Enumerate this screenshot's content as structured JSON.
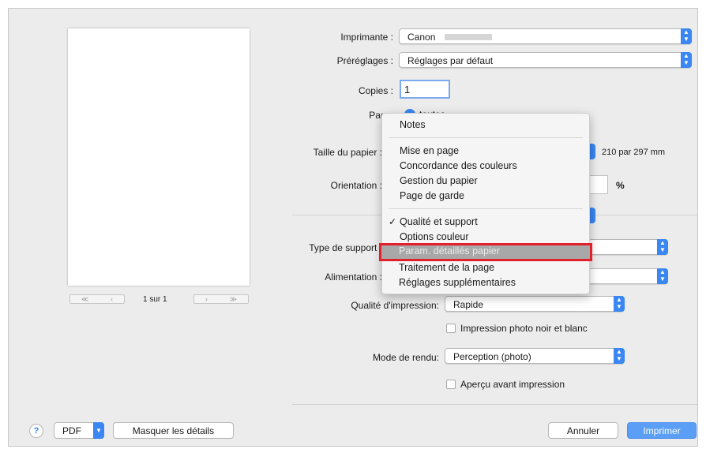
{
  "preview": {
    "page_counter": "1 sur 1",
    "first_label": "≪",
    "prev_label": "‹",
    "next_label": "›",
    "last_label": "≫"
  },
  "fields": {
    "printer_label": "Imprimante :",
    "printer_value": "Canon",
    "presets_label": "Préréglages :",
    "presets_value": "Réglages par défaut",
    "copies_label": "Copies :",
    "copies_value": "1",
    "pages_label": "Pages :",
    "pages_value": "toutes",
    "paper_size_label": "Taille du papier :",
    "paper_size_value": "210 par 297 mm",
    "orientation_label": "Orientation :",
    "scale_unit": "%",
    "media_type_label": "Type de support :",
    "paper_source_label": "Alimentation :",
    "print_quality_label": "Qualité d'impression:",
    "print_quality_value": "Rapide",
    "bw_photo_label": "Impression photo noir et blanc",
    "render_mode_label": "Mode de rendu:",
    "render_mode_value": "Perception (photo)",
    "preview_before_label": "Aperçu avant impression"
  },
  "menu": {
    "items": [
      "Notes",
      "Mise en page",
      "Concordance des couleurs",
      "Gestion du papier",
      "Page de garde",
      "Qualité et support",
      "Options couleur",
      "Param. détaillés papier",
      "Traitement de la page",
      "Réglages supplémentaires"
    ],
    "checked_mark": "✓",
    "highlighted_item": "Param. détaillés papier",
    "highlight_color": "#e2202b"
  },
  "bottom": {
    "help_label": "?",
    "pdf_label": "PDF",
    "hide_details_label": "Masquer les détails",
    "cancel_label": "Annuler",
    "print_label": "Imprimer"
  },
  "colors": {
    "accent": "#3a86f2",
    "dialog_bg": "#ececec"
  }
}
